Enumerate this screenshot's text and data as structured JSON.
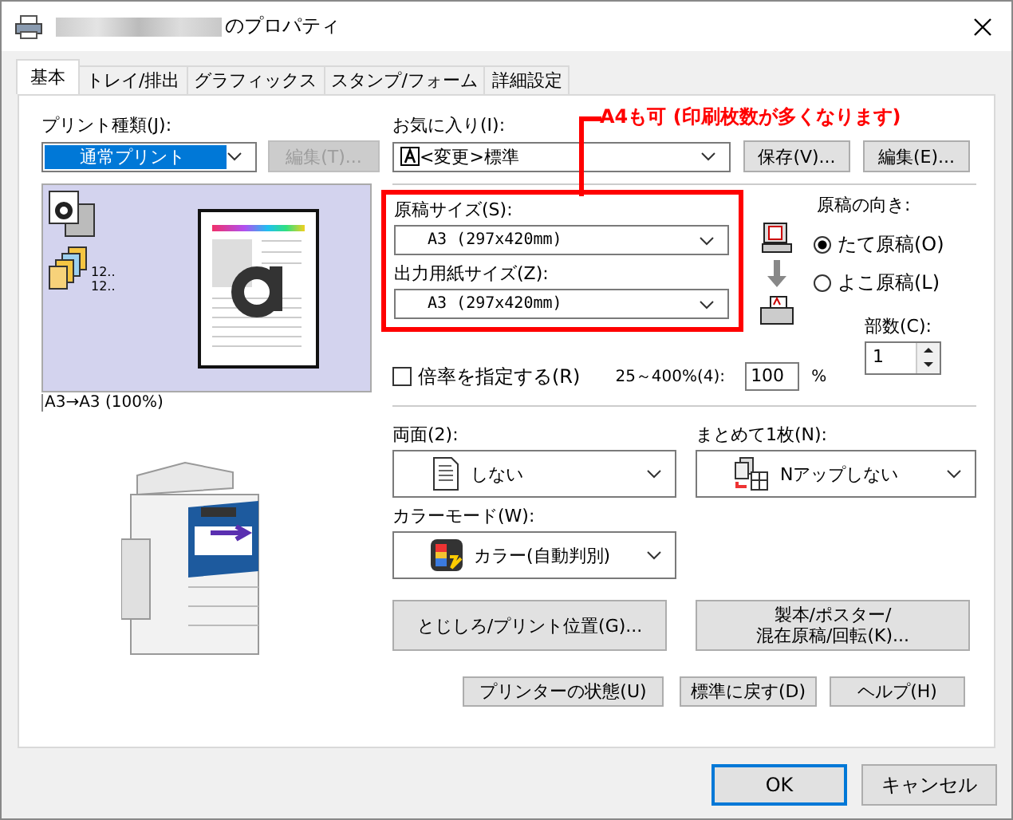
{
  "window": {
    "title": "のプロパティ"
  },
  "tabs": [
    {
      "label": "基本",
      "selected": true
    },
    {
      "label": "トレイ/排出",
      "selected": false
    },
    {
      "label": "グラフィックス",
      "selected": false
    },
    {
      "label": "スタンプ/フォーム",
      "selected": false
    },
    {
      "label": "詳細設定",
      "selected": false
    }
  ],
  "print_type": {
    "label": "プリント種類(J):",
    "value": "通常プリント",
    "edit_button": {
      "label": "編集(T)...",
      "disabled": true
    }
  },
  "preview": {
    "counters": [
      "12..",
      "12.."
    ],
    "caption": "A3→A3 (100%)"
  },
  "favorites": {
    "label": "お気に入り(I):",
    "value": "<変更>標準",
    "buttons": [
      "保存(V)...",
      "編集(E)..."
    ]
  },
  "annotation": "A4も可 (印刷枚数が多くなります)",
  "original_size": {
    "label": "原稿サイズ(S):",
    "value": "A3 (297x420mm)"
  },
  "output_size": {
    "label": "出力用紙サイズ(Z):",
    "value": "A3 (297x420mm)"
  },
  "orientation": {
    "label": "原稿の向き:",
    "options": [
      {
        "label": "たて原稿(O)",
        "selected": true
      },
      {
        "label": "よこ原稿(L)",
        "selected": false
      }
    ]
  },
  "copies": {
    "label": "部数(C):",
    "value": "1"
  },
  "scale": {
    "label": "倍率を指定する(R)",
    "checked": false,
    "range": "25～400%(4):",
    "value": "100",
    "unit": "%"
  },
  "duplex": {
    "label": "両面(2):",
    "value": "しない"
  },
  "nup": {
    "label": "まとめて1枚(N):",
    "value": "Nアップしない"
  },
  "color_mode": {
    "label": "カラーモード(W):",
    "value": "カラー(自動判別)"
  },
  "action_buttons": [
    "とじしろ/プリント位置(G)...",
    "製本/ポスター/\n混在原稿/回転(K)..."
  ],
  "small_buttons": [
    "プリンターの状態(U)",
    "標準に戻す(D)",
    "ヘルプ(H)"
  ],
  "dialog_buttons": [
    {
      "label": "OK",
      "default": true
    },
    {
      "label": "キャンセル",
      "default": false
    }
  ]
}
